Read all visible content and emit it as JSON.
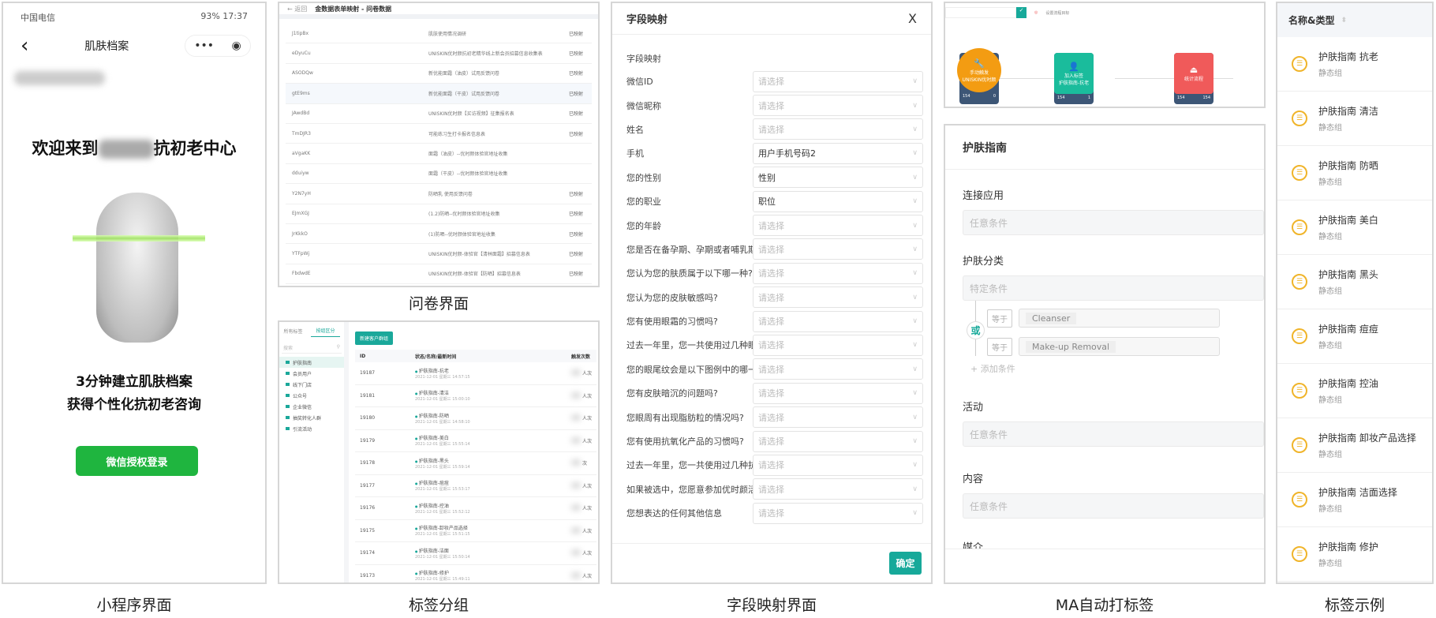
{
  "captions": {
    "phone": "小程序界面",
    "questionnaire": "问卷界面",
    "tag_group": "标签分组",
    "field_mapping": "字段映射界面",
    "ma": "MA自动打标签",
    "tag_examples": "标签示例"
  },
  "colors": {
    "accent": "#17a99a",
    "wechat_green": "#1fb53f",
    "tag_icon": "#f0b429"
  },
  "phone": {
    "carrier": "中国电信",
    "battery": "93%",
    "time": "17:37",
    "title": "肌肤档案",
    "back_icon": "chevron-left-icon",
    "more_icon": "more-icon",
    "close_icon": "target-icon",
    "welcome_prefix": "欢迎来到",
    "welcome_suffix": "抗初老中心",
    "subtitle_line1": "3分钟建立肌肤档案",
    "subtitle_line2": "获得个性化抗初老咨询",
    "login_button": "微信授权登录"
  },
  "questionnaire": {
    "back": "← 返回",
    "title": "金数据表单映射 - 问卷数据",
    "rows": [
      {
        "id": "J1tipBx",
        "name": "肌肤使用情况调研",
        "status": "已映射"
      },
      {
        "id": "eDyuCu",
        "name": "UNISKIN优时颜抗初老精华线上新会员招募信息收集表",
        "status": "已映射"
      },
      {
        "id": "ASODQw",
        "name": "新优能面霜（油皮）试用反馈问卷",
        "status": "已映射"
      },
      {
        "id": "gtE9ms",
        "name": "新优能面霜（干皮）试用反馈问卷",
        "status": "已映射"
      },
      {
        "id": "JAwdBd",
        "name": "UNISKIN优时颜【买访视频】征集报名表",
        "status": "已映射"
      },
      {
        "id": "TmDJR3",
        "name": "可能练习生打卡报名信息表",
        "status": "已映射"
      },
      {
        "id": "aVgaKK",
        "name": "面霜（油皮）--优时颜体验官地址收集",
        "status": ""
      },
      {
        "id": "dduiyw",
        "name": "面霜（干皮）--优时颜体验官地址收集",
        "status": ""
      },
      {
        "id": "Y2N7yH",
        "name": "防晒乳 使用反馈问卷",
        "status": "已映射"
      },
      {
        "id": "EJmXGJ",
        "name": "(1.2)防晒--优时颜体验官地址收集",
        "status": "已映射"
      },
      {
        "id": "JrKkkO",
        "name": "(1)防晒--优时颜体验官地址收集",
        "status": "已映射"
      },
      {
        "id": "YTFpWj",
        "name": "UNISKIN优时颜-体验官【清林面霜】招募信息表",
        "status": "已映射"
      },
      {
        "id": "FbdwdE",
        "name": "UNISKIN优时颜-体验官【防晒】招募信息表",
        "status": "已映射"
      }
    ]
  },
  "tag_group": {
    "tabs": [
      "所有标签",
      "按组区分"
    ],
    "search_placeholder": "搜索",
    "sidebar": [
      "护肤指南",
      "会员用户",
      "线下门店",
      "公众号",
      "企业微信",
      "抽奖转化人群",
      "引流活动"
    ],
    "new_button": "新建客户群组",
    "columns": [
      "ID",
      "状态/名称/最新时间",
      "触发次数"
    ],
    "rows": [
      {
        "id": "19187",
        "name": "护肤指南-抗老",
        "date": "2021-12-01 星期三 14:57:15",
        "count": "人次"
      },
      {
        "id": "19181",
        "name": "护肤指南-清洁",
        "date": "2021-12-01 星期三 15:00:10",
        "count": "人次"
      },
      {
        "id": "19180",
        "name": "护肤指南-防晒",
        "date": "2021-12-01 星期三 14:58:10",
        "count": "人次"
      },
      {
        "id": "19179",
        "name": "护肤指南-美白",
        "date": "2021-12-01 星期三 15:55:14",
        "count": "人次"
      },
      {
        "id": "19178",
        "name": "护肤指南-黑头",
        "date": "2021-12-01 星期三 15:59:14",
        "count": "次"
      },
      {
        "id": "19177",
        "name": "护肤指南-痘痘",
        "date": "2021-12-01 星期三 15:53:17",
        "count": "人次"
      },
      {
        "id": "19176",
        "name": "护肤指南-控油",
        "date": "2021-12-01 星期三 15:52:12",
        "count": "人次"
      },
      {
        "id": "19175",
        "name": "护肤指南-卸妆产品选择",
        "date": "2021-12-01 星期三 15:51:15",
        "count": "人次"
      },
      {
        "id": "19174",
        "name": "护肤指南-洁面",
        "date": "2021-12-01 星期三 15:50:14",
        "count": "人次"
      },
      {
        "id": "19173",
        "name": "护肤指南-修护",
        "date": "2021-12-01 星期三 15:49:11",
        "count": "人次"
      }
    ]
  },
  "field_mapping": {
    "title": "字段映射",
    "close": "X",
    "section": "字段映射",
    "placeholder": "请选择",
    "rows": [
      {
        "label": "微信ID",
        "value": ""
      },
      {
        "label": "微信昵称",
        "value": ""
      },
      {
        "label": "姓名",
        "value": ""
      },
      {
        "label": "手机",
        "value": "用户手机号码2"
      },
      {
        "label": "您的性别",
        "value": "性别"
      },
      {
        "label": "您的职业",
        "value": "职位"
      },
      {
        "label": "您的年龄",
        "value": ""
      },
      {
        "label": "您是否在备孕期、孕期或者哺乳期",
        "value": ""
      },
      {
        "label": "您认为您的肤质属于以下哪一种?",
        "value": ""
      },
      {
        "label": "您认为您的皮肤敏感吗?",
        "value": ""
      },
      {
        "label": "您有使用眼霜的习惯吗?",
        "value": ""
      },
      {
        "label": "过去一年里，您一共使用过几种眼霜",
        "value": ""
      },
      {
        "label": "您的眼尾纹会是以下图例中的哪一种",
        "value": ""
      },
      {
        "label": "您有皮肤暗沉的问题吗?",
        "value": ""
      },
      {
        "label": "您眼周有出现脂肪粒的情况吗?",
        "value": ""
      },
      {
        "label": "您有使用抗氧化产品的习惯吗?",
        "value": ""
      },
      {
        "label": "过去一年里，您一共使用过几种抗氧化产品",
        "value": ""
      },
      {
        "label": "如果被选中，您愿意参加优时颜活动吗",
        "value": ""
      },
      {
        "label": "您想表达的任何其他信息",
        "value": ""
      }
    ],
    "confirm": "确定"
  },
  "ma_flow": {
    "toolbar_label": "设置流程目标",
    "nodes": [
      {
        "title": "手动触发",
        "sub": "UNISKIN优时颜",
        "icon": "wrench-icon",
        "color": "#f39c12",
        "in": "154",
        "out": "0"
      },
      {
        "title": "加入标签",
        "sub": "护肤指南-抗老",
        "icon": "user-plus-icon",
        "color": "#1abc9c",
        "in": "154",
        "out": "1"
      },
      {
        "title": "统计流程",
        "sub": "",
        "icon": "eject-icon",
        "color": "#f05a5a",
        "in": "154",
        "out": "154"
      }
    ]
  },
  "ma_form": {
    "title": "护肤指南",
    "fields": [
      {
        "label": "连接应用",
        "value": "任意条件"
      },
      {
        "label": "护肤分类",
        "value": "特定条件"
      }
    ],
    "or_label": "或",
    "conditions": [
      {
        "op": "等于",
        "value": "Cleanser"
      },
      {
        "op": "等于",
        "value": "Make-up Removal"
      }
    ],
    "add_condition": "+ 添加条件",
    "fields_after": [
      {
        "label": "活动",
        "value": "任意条件"
      },
      {
        "label": "内容",
        "value": "任意条件"
      },
      {
        "label": "媒介",
        "value": ""
      }
    ]
  },
  "tag_examples": {
    "header": "名称&类型",
    "items": [
      {
        "name": "护肤指南 抗老",
        "type": "静态组"
      },
      {
        "name": "护肤指南 清洁",
        "type": "静态组"
      },
      {
        "name": "护肤指南 防晒",
        "type": "静态组"
      },
      {
        "name": "护肤指南 美白",
        "type": "静态组"
      },
      {
        "name": "护肤指南 黑头",
        "type": "静态组"
      },
      {
        "name": "护肤指南 痘痘",
        "type": "静态组"
      },
      {
        "name": "护肤指南 控油",
        "type": "静态组"
      },
      {
        "name": "护肤指南 卸妆产品选择",
        "type": "静态组"
      },
      {
        "name": "护肤指南 洁面选择",
        "type": "静态组"
      },
      {
        "name": "护肤指南 修护",
        "type": "静态组"
      }
    ]
  }
}
